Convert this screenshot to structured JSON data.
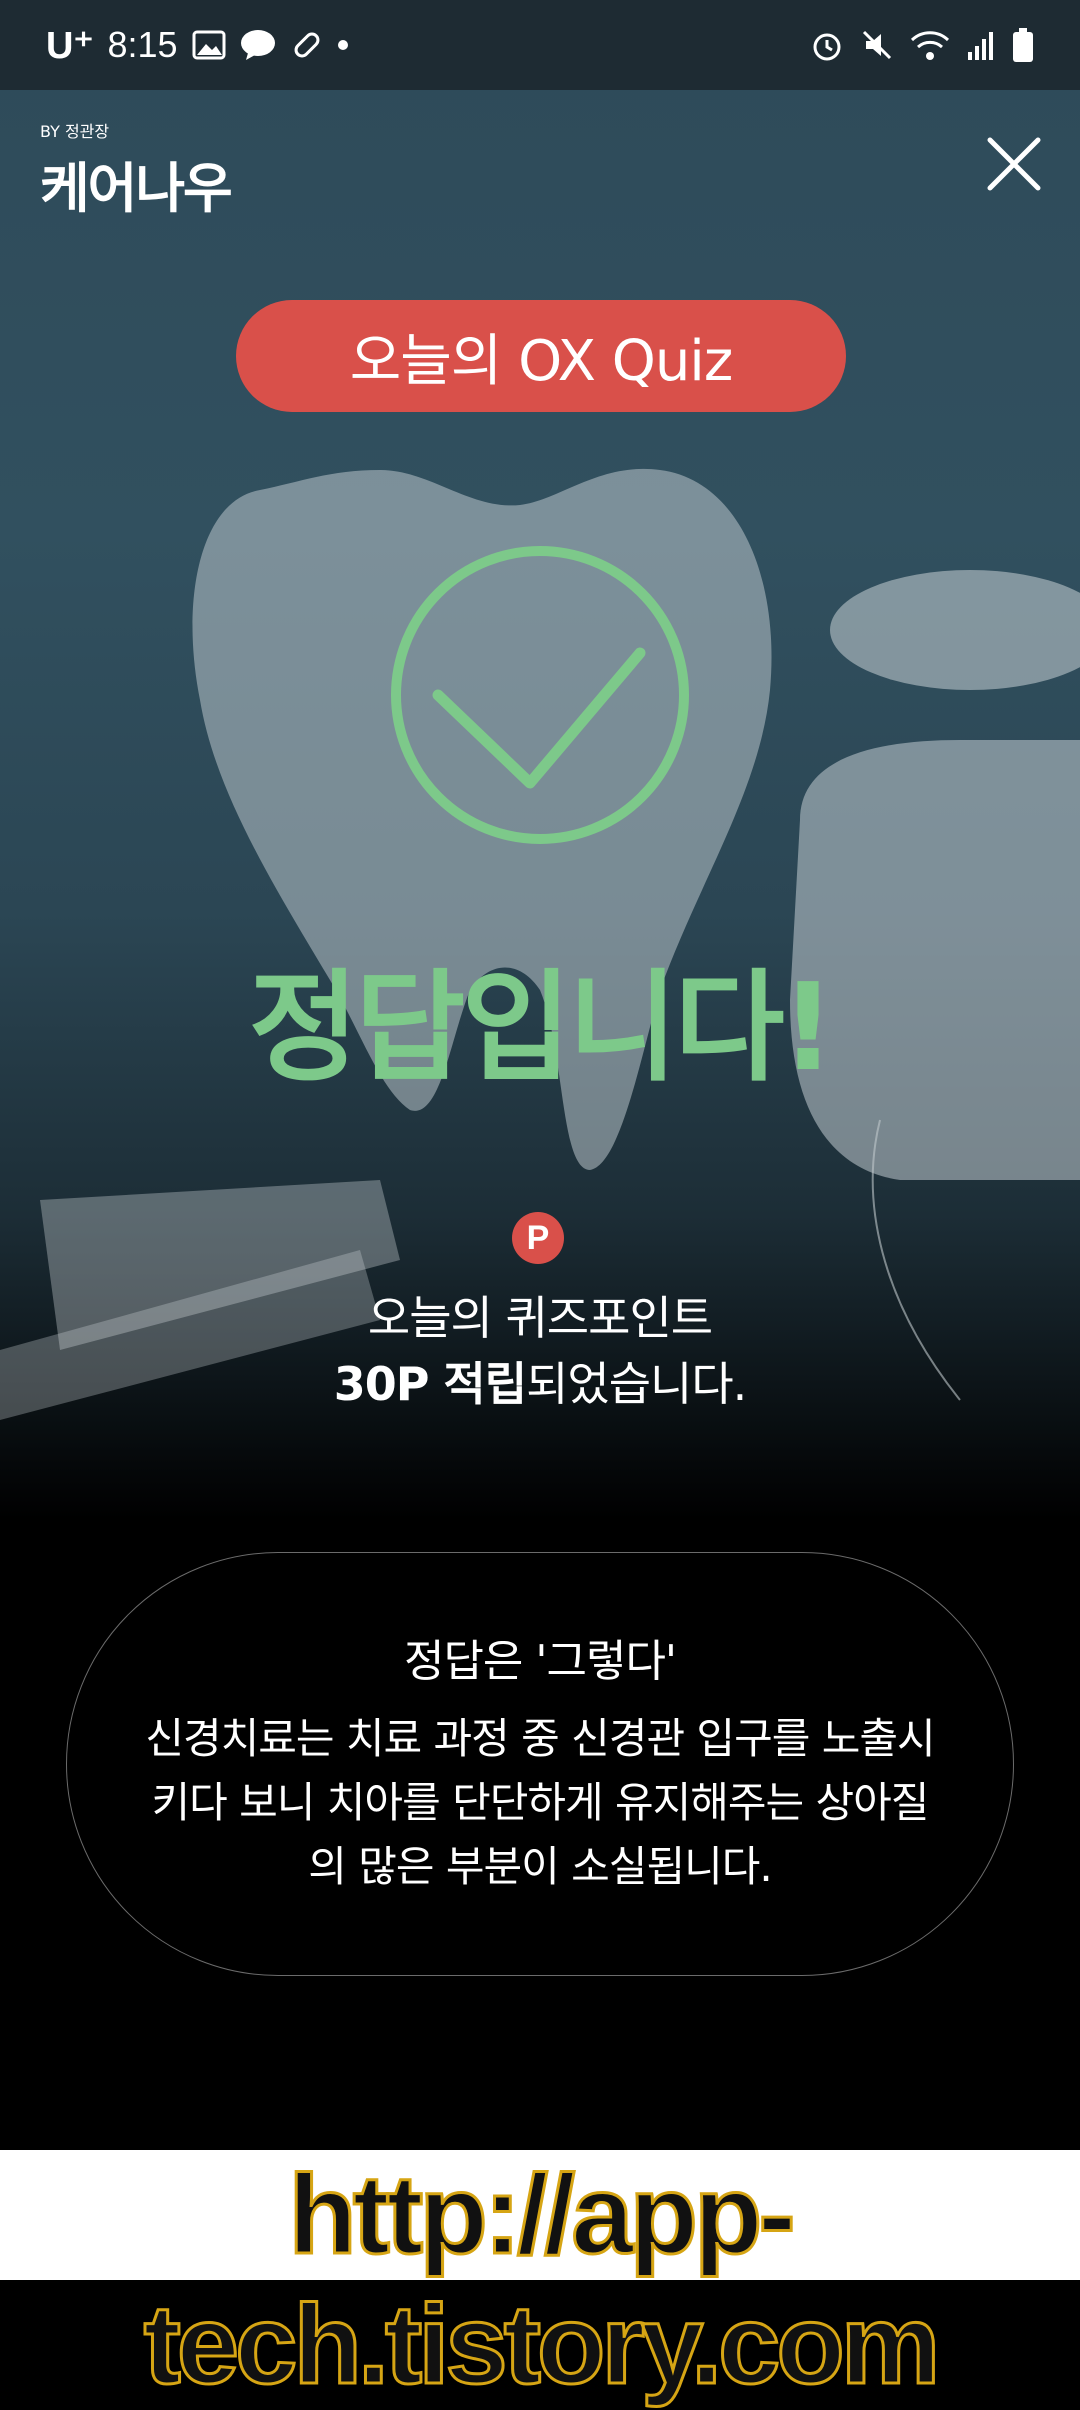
{
  "status_bar": {
    "carrier": "U⁺",
    "time": "8:15",
    "left_icons": [
      "gallery-icon",
      "messenger-icon",
      "talk-icon",
      "pill-icon",
      "dot-icon"
    ],
    "right_icons": [
      "alarm-icon",
      "mute-icon",
      "wifi-icon",
      "signal-icon",
      "battery-icon"
    ]
  },
  "header": {
    "logo_by": "BY 정관장",
    "logo_name": "케어나우"
  },
  "quiz": {
    "pill_label": "오늘의 OX Quiz",
    "result_text": "정답입니다!",
    "point_badge": "P",
    "point_line1": "오늘의 퀴즈포인트",
    "point_bold": "30P 적립",
    "point_rest": "되었습니다."
  },
  "answer": {
    "title": "정답은 '그렇다'",
    "body": "신경치료는 치료 과정 중 신경관 입구를 노출시키다 보니 치아를 단단하게 유지해주는 상아질의 많은 부분이 소실됩니다."
  },
  "watermark": "http://app-tech.tistory.com",
  "colors": {
    "accent_red": "#d9504a",
    "correct_green": "#7dc98a"
  }
}
